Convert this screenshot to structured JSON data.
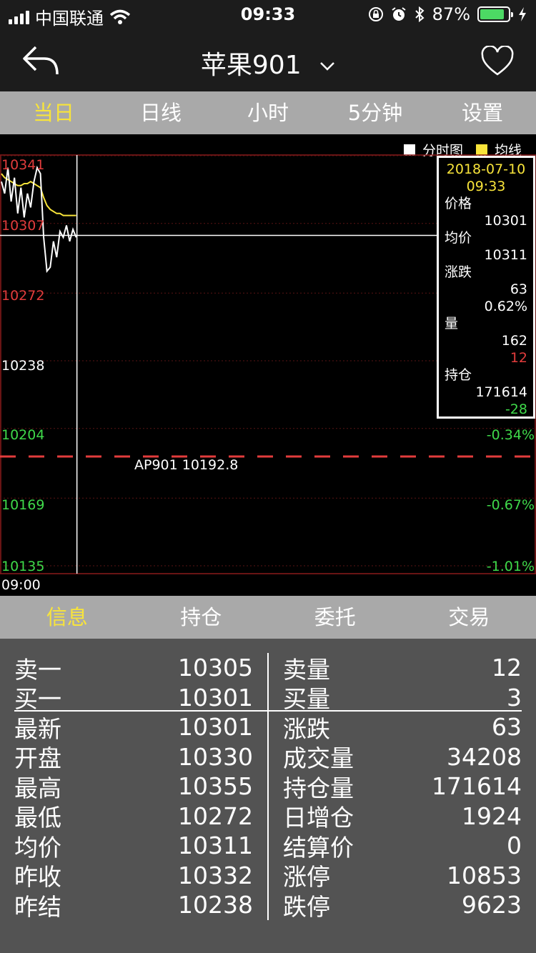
{
  "status_bar": {
    "carrier": "中国联通",
    "time": "09:33",
    "battery_pct": "87%",
    "battery_level": 0.87
  },
  "nav": {
    "title": "苹果901"
  },
  "period_tabs": [
    "当日",
    "日线",
    "小时",
    "5分钟",
    "设置"
  ],
  "chart": {
    "legend": {
      "minute": "分时图",
      "avg": "均线"
    },
    "y_labels": [
      "10341",
      "10307",
      "10272",
      "10238",
      "10204",
      "10169",
      "10135"
    ],
    "pct_labels": [
      "-0.34%",
      "-0.67%",
      "-1.01%"
    ],
    "settle_label": "AP901 10192.8",
    "time_start": "09:00",
    "colors": {
      "up": "#e23c3c",
      "down": "#3fd94a",
      "price_line": "#ffffff",
      "avg_line": "#f8e43a",
      "accent": "#f8e43a"
    },
    "info": {
      "date": "2018-07-10",
      "time": "09:33",
      "price_label": "价格",
      "price": "10301",
      "avg_label": "均价",
      "avg": "10311",
      "change_label": "涨跌",
      "change": "63",
      "change_pct": "0.62%",
      "volume_label": "量",
      "volume": "162",
      "volume_delta": "12",
      "oi_label": "持仓",
      "oi": "171614",
      "oi_delta": "-28"
    }
  },
  "chart_data": {
    "type": "line",
    "series": [
      {
        "name": "分时图",
        "values": [
          10328,
          10322,
          10335,
          10318,
          10330,
          10312,
          10325,
          10310,
          10322,
          10315,
          10328,
          10335,
          10332,
          10300,
          10283,
          10285,
          10298,
          10290,
          10303,
          10300,
          10306,
          10298,
          10304,
          10300
        ]
      },
      {
        "name": "均线",
        "values": [
          10332,
          10330,
          10329,
          10328,
          10327,
          10326,
          10326,
          10327,
          10327,
          10328,
          10327,
          10326,
          10325,
          10320,
          10316,
          10314,
          10313,
          10312,
          10312,
          10311,
          10311,
          10311,
          10311,
          10311
        ]
      }
    ],
    "crosshair_price": 10301,
    "settlement_reference": 10192.8,
    "ylim": [
      10135,
      10341
    ],
    "x_start": "09:00"
  },
  "bottom_tabs": [
    "信息",
    "持仓",
    "委托",
    "交易"
  ],
  "quote": {
    "left": [
      {
        "label": "卖一",
        "value": "10305"
      },
      {
        "label": "买一",
        "value": "10301"
      },
      {
        "label": "最新",
        "value": "10301"
      },
      {
        "label": "开盘",
        "value": "10330"
      },
      {
        "label": "最高",
        "value": "10355"
      },
      {
        "label": "最低",
        "value": "10272"
      },
      {
        "label": "均价",
        "value": "10311"
      },
      {
        "label": "昨收",
        "value": "10332"
      },
      {
        "label": "昨结",
        "value": "10238"
      }
    ],
    "right": [
      {
        "label": "卖量",
        "value": "12"
      },
      {
        "label": "买量",
        "value": "3"
      },
      {
        "label": "涨跌",
        "value": "63"
      },
      {
        "label": "成交量",
        "value": "34208"
      },
      {
        "label": "持仓量",
        "value": "171614"
      },
      {
        "label": "日增仓",
        "value": "1924"
      },
      {
        "label": "结算价",
        "value": "0"
      },
      {
        "label": "涨停",
        "value": "10853"
      },
      {
        "label": "跌停",
        "value": "9623"
      }
    ]
  }
}
